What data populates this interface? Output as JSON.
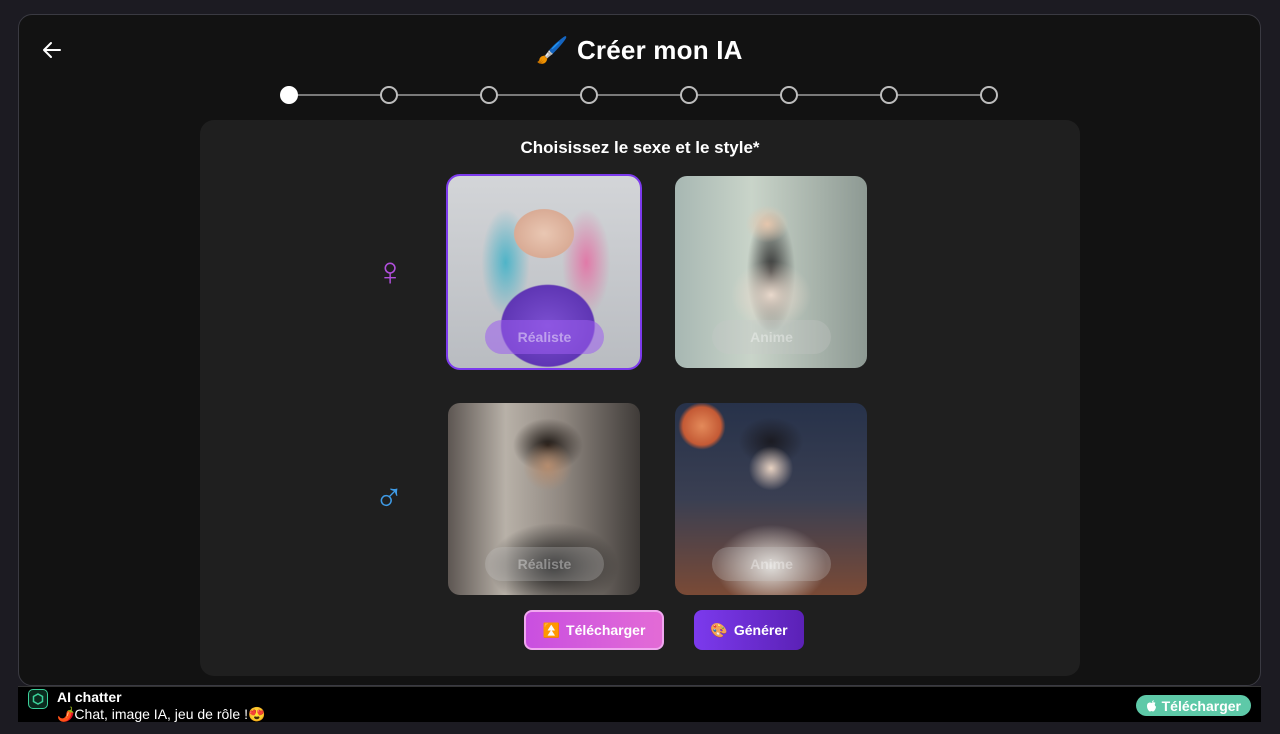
{
  "header": {
    "back_icon": "arrow-left-icon",
    "title_emoji": "🖌️",
    "title": "Créer mon IA"
  },
  "stepper": {
    "total_steps": 8,
    "current_step": 1
  },
  "panel": {
    "title": "Choisissez le sexe et le style*"
  },
  "genders": {
    "female_symbol": "♀",
    "male_symbol": "♂"
  },
  "cards": [
    {
      "gender": "female",
      "style": "Réaliste",
      "selected": true
    },
    {
      "gender": "female",
      "style": "Anime",
      "selected": false
    },
    {
      "gender": "male",
      "style": "Réaliste",
      "selected": false
    },
    {
      "gender": "male",
      "style": "Anime",
      "selected": false
    }
  ],
  "actions": {
    "upload_emoji": "⏫",
    "upload_label": "Télécharger",
    "generate_emoji": "🎨",
    "generate_label": "Générer"
  },
  "footer": {
    "app_name": "AI chatter",
    "tagline": "🌶️Chat, image IA, jeu de rôle !😍",
    "download_icon": "apple-icon",
    "download_label": "Télécharger"
  },
  "colors": {
    "accent_purple": "#7c3aed",
    "female_color": "#b14fdc",
    "male_color": "#3f9be6",
    "download_green": "#5ec9a8"
  }
}
